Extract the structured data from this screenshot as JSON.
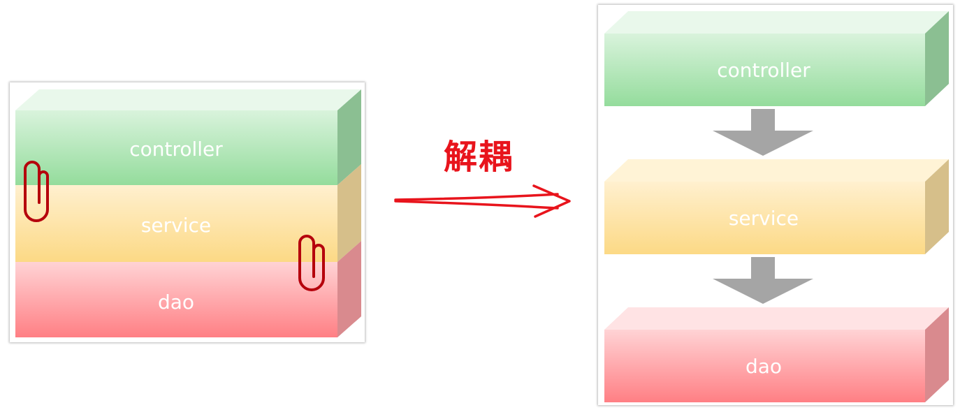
{
  "left_stack": {
    "layers": [
      {
        "label": "controller",
        "color": "#9fe0a6"
      },
      {
        "label": "service",
        "color": "#fde09a"
      },
      {
        "label": "dao",
        "color": "#ff8a8d"
      }
    ]
  },
  "transition": {
    "label": "解耦",
    "color": "#e8141c"
  },
  "right_stack": {
    "layers": [
      {
        "label": "controller",
        "color": "#9fe0a6"
      },
      {
        "label": "service",
        "color": "#fde09a"
      },
      {
        "label": "dao",
        "color": "#ff8a8d"
      }
    ],
    "connector_color": "#a5a5a5"
  },
  "clip_color": "#b5000c"
}
